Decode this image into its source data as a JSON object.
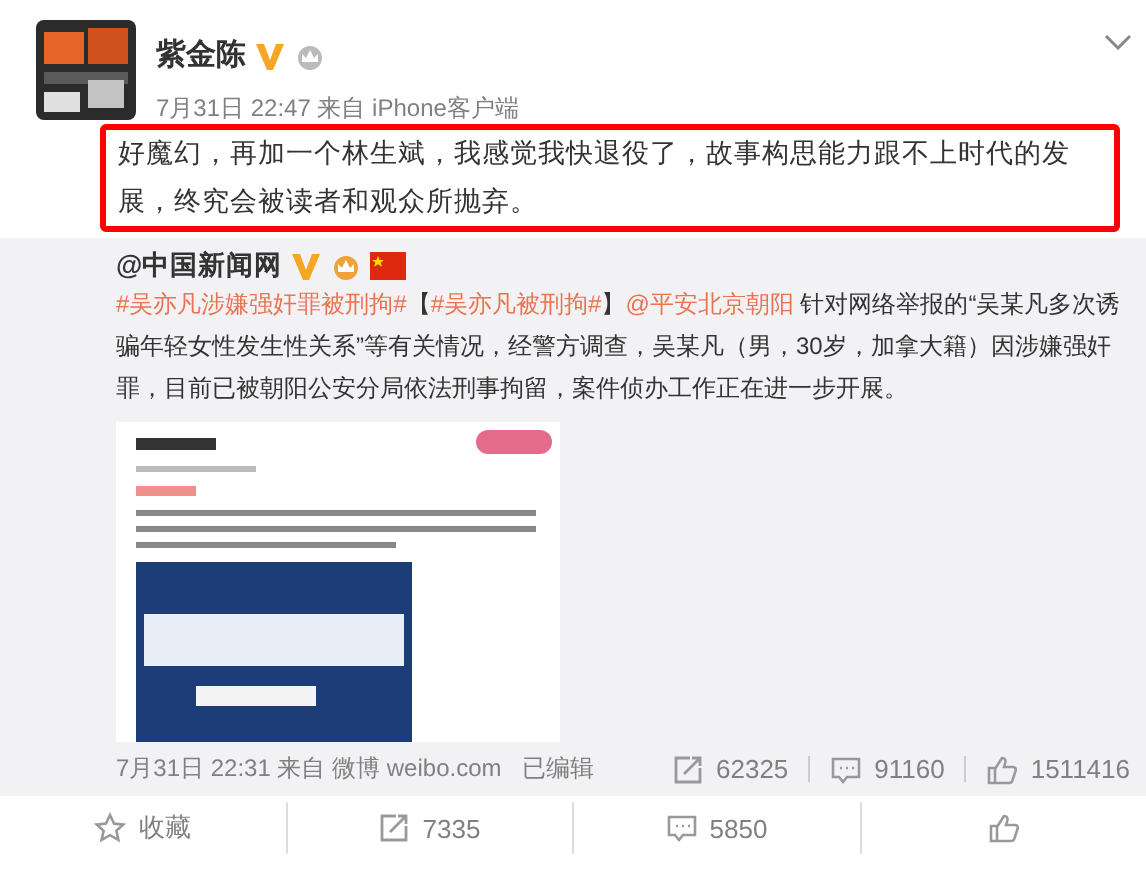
{
  "post": {
    "author": "紫金陈",
    "verified": true,
    "time": "7月31日 22:47 来自 iPhone客户端",
    "text": "好魔幻，再加一个林生斌，我感觉我快退役了，故事构思能力跟不上时代的发展，终究会被读者和观众所抛弃。",
    "highlighted": true
  },
  "repost": {
    "author": "@中国新闻网",
    "verified": true,
    "segments": [
      {
        "kind": "tag",
        "text": "#吴亦凡涉嫌强奸罪被刑拘#"
      },
      {
        "kind": "plain",
        "text": "【"
      },
      {
        "kind": "tag",
        "text": "#吴亦凡被刑拘#"
      },
      {
        "kind": "plain",
        "text": "】"
      },
      {
        "kind": "mention",
        "text": "@平安北京朝阳"
      },
      {
        "kind": "plain",
        "text": " 针对网络举报的“吴某凡多次诱骗年轻女性发生性关系”等有关情况，经警方调查，吴某凡（男，30岁，加拿大籍）因涉嫌强奸罪，目前已被朝阳公安分局依法刑事拘留，案件侦办工作正在进一步开展。"
      }
    ],
    "time": "7月31日 22:31 来自 微博 weibo.com",
    "edited": "已编辑",
    "stats": [
      {
        "kind": "repost",
        "count": "62325"
      },
      {
        "kind": "comment",
        "count": "91160"
      },
      {
        "kind": "like",
        "count": "1511416"
      }
    ]
  },
  "actions": [
    {
      "kind": "favorite",
      "label": "收藏"
    },
    {
      "kind": "repost",
      "label": "7335"
    },
    {
      "kind": "comment",
      "label": "5850"
    },
    {
      "kind": "like"
    }
  ]
}
